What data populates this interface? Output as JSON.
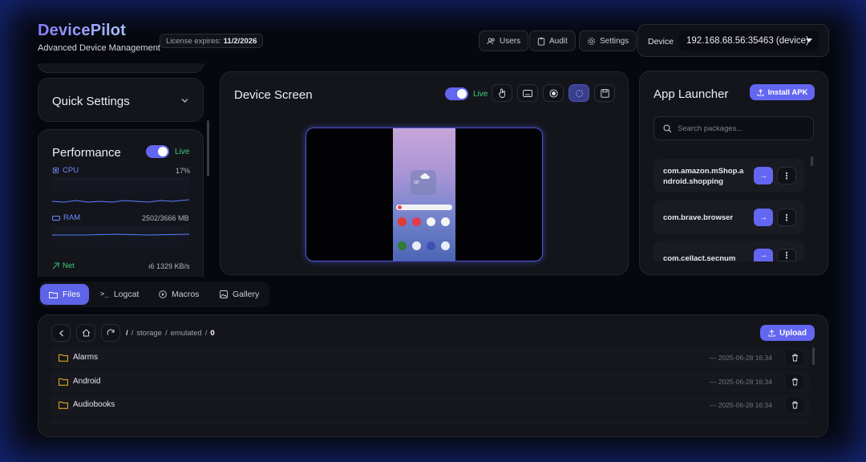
{
  "brand": {
    "title": "DevicePilot",
    "subtitle": "Advanced Device Management"
  },
  "license": {
    "label": "License expires:",
    "date": "11/2/2026"
  },
  "topbar": {
    "users": "Users",
    "audit": "Audit",
    "settings": "Settings"
  },
  "device": {
    "label": "Device",
    "selected": "192.168.68.56:35463 (device)"
  },
  "quick_settings": {
    "title": "Quick Settings"
  },
  "performance": {
    "title": "Performance",
    "live": "Live",
    "cpu": {
      "label": "CPU",
      "value": "17%"
    },
    "ram": {
      "label": "RAM",
      "value": "2502/3666 MB"
    },
    "net": {
      "label": "Net",
      "value": "ı6 1329 KB/s"
    }
  },
  "device_screen": {
    "title": "Device Screen",
    "live": "Live",
    "weather_temp": "15°"
  },
  "app_launcher": {
    "title": "App Launcher",
    "install": "Install APK",
    "search_placeholder": "Search packages...",
    "packages": [
      {
        "name": "com.amazon.mShop.a ndroid.shopping"
      },
      {
        "name": "com.brave.browser"
      },
      {
        "name": "com.cellact.secnum"
      }
    ]
  },
  "tabs": [
    {
      "label": "Files"
    },
    {
      "label": "Logcat"
    },
    {
      "label": "Macros"
    },
    {
      "label": "Gallery"
    }
  ],
  "files": {
    "breadcrumb": {
      "root": "/",
      "p1": "storage",
      "p2": "emulated",
      "current": "0"
    },
    "upload": "Upload",
    "rows": [
      {
        "name": "Alarms",
        "date": "— 2025-06-28 16:34"
      },
      {
        "name": "Android",
        "date": "— 2025-06-28 16:34"
      },
      {
        "name": "Audiobooks",
        "date": "— 2025-06-28 16:34"
      }
    ]
  },
  "colors": {
    "accent": "#6366f1",
    "live": "#3ad07d",
    "folder": "#f0b429"
  }
}
